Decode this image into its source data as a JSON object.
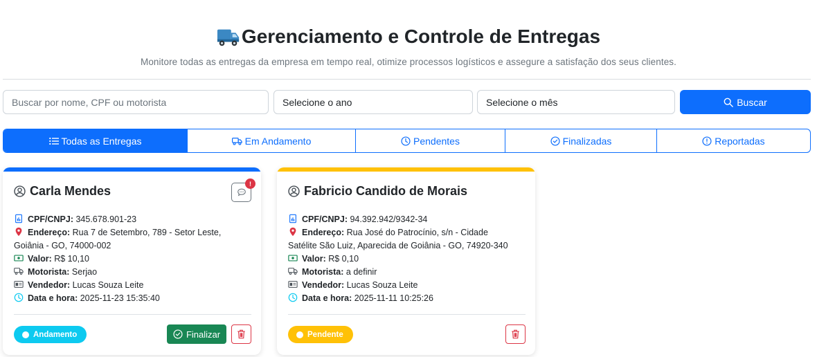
{
  "header": {
    "title": "Gerenciamento e Controle de Entregas",
    "subtitle": "Monitore todas as entregas da empresa em tempo real, otimize processos logísticos e assegure a satisfação dos seus clientes.",
    "icon": "truck-icon"
  },
  "search": {
    "placeholder": "Buscar por nome, CPF ou motorista",
    "value": "",
    "year_select": "Selecione o ano",
    "month_select": "Selecione o mês",
    "button_label": "Buscar"
  },
  "tabs": [
    {
      "label": "Todas as Entregas",
      "icon": "list-icon",
      "active": true
    },
    {
      "label": "Em Andamento",
      "icon": "truck-icon",
      "active": false
    },
    {
      "label": "Pendentes",
      "icon": "clock-icon",
      "active": false
    },
    {
      "label": "Finalizadas",
      "icon": "check-circle-icon",
      "active": false
    },
    {
      "label": "Reportadas",
      "icon": "exclamation-circle-icon",
      "active": false
    }
  ],
  "labels": {
    "cpf": "CPF/CNPJ:",
    "endereco": "Endereço:",
    "valor": "Valor:",
    "motorista": "Motorista:",
    "vendedor": "Vendedor:",
    "data": "Data e hora:"
  },
  "cards": [
    {
      "name": "Carla Mendes",
      "cpf": "345.678.901-23",
      "endereco_1": "Rua 7 de Setembro, 789 - Setor Leste,",
      "endereco_2": "Goiânia - GO, 74000-002",
      "valor": "R$ 10,10",
      "motorista": "Serjao",
      "vendedor": "Lucas Souza Leite",
      "data": "2025-11-23 15:35:40",
      "status": "Andamento",
      "status_color": "#0dcaf0",
      "bar_color": "#0d6efd",
      "finalizar_label": "Finalizar",
      "chat_badge": "!"
    },
    {
      "name": "Fabricio Candido de Morais",
      "cpf": "94.392.942/9342-34",
      "endereco_1": "Rua José do Patrocínio, s/n - Cidade",
      "endereco_2": "Satélite São Luiz, Aparecida de Goiânia - GO, 74920-340",
      "valor": "R$ 0,10",
      "motorista": "a definir",
      "vendedor": "Lucas Souza Leite",
      "data": "2025-11-11 10:25:26",
      "status": "Pendente",
      "status_color": "#ffc107",
      "bar_color": "#ffc107"
    }
  ],
  "colors": {
    "primary": "#0d6efd",
    "success": "#198754",
    "danger": "#dc3545",
    "info": "#0dcaf0",
    "warning": "#ffc107"
  }
}
